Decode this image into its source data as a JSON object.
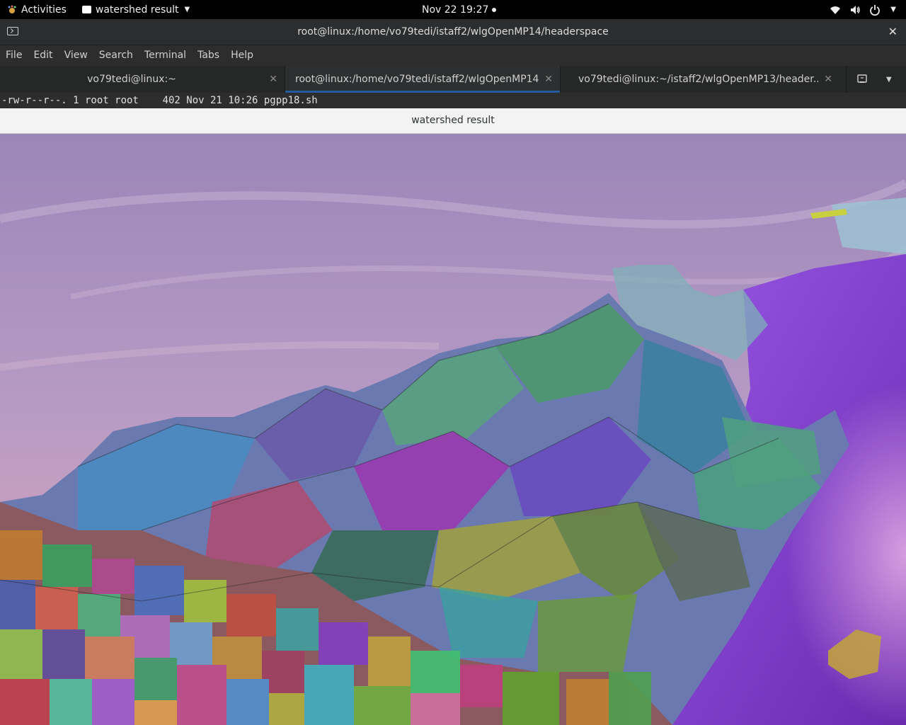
{
  "topbar": {
    "activities": "Activities",
    "app_name": "watershed result",
    "clock": "Nov 22  19:27",
    "tray_icons": [
      "wifi-icon",
      "volume-icon",
      "power-icon"
    ]
  },
  "terminal": {
    "title": "root@linux:/home/vo79tedi/istaff2/wlgOpenMP14/headerspace",
    "menu": [
      "File",
      "Edit",
      "View",
      "Search",
      "Terminal",
      "Tabs",
      "Help"
    ],
    "tabs": [
      {
        "label": "vo79tedi@linux:~",
        "active": false
      },
      {
        "label": "root@linux:/home/vo79tedi/istaff2/wlgOpenMP14/...",
        "active": true
      },
      {
        "label": "vo79tedi@linux:~/istaff2/wlgOpenMP13/header...",
        "active": false
      }
    ],
    "output_line": "-rw-r--r--. 1 root root    402 Nov 21 10:26 pgpp18.sh"
  },
  "image_window": {
    "title": "watershed result",
    "content": "watershed segmentation overlay on mountain landscape photo",
    "colors": {
      "sky_top": "#9c86b6",
      "sky_bottom": "#c8a2c2",
      "violet_region": "#8a3fd6"
    }
  }
}
